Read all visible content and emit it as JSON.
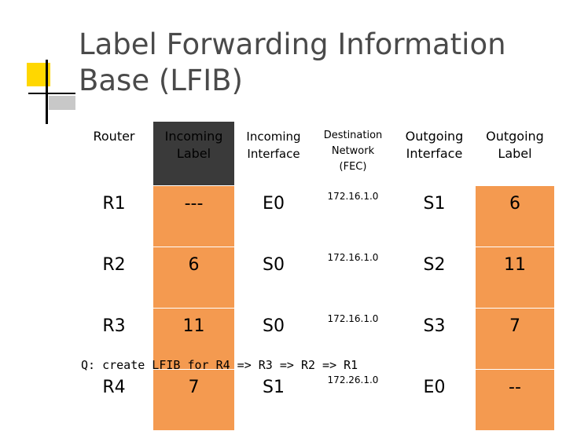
{
  "slide": {
    "title_line1": "Label Forwarding Information",
    "title_line2": "Base (LFIB)"
  },
  "table": {
    "headers": {
      "router": "Router",
      "incoming_label_line1": "Incoming",
      "incoming_label_line2": "Label",
      "incoming_interface_line1": "Incoming",
      "incoming_interface_line2": "Interface",
      "destination_line1": "Destination",
      "destination_line2": "Network",
      "destination_line3": "(FEC)",
      "outgoing_interface_line1": "Outgoing",
      "outgoing_interface_line2": "Interface",
      "outgoing_label_line1": "Outgoing",
      "outgoing_label_line2": "Label"
    },
    "rows": [
      {
        "router": "R1",
        "incoming_label": "---",
        "incoming_interface": "E0",
        "destination": "172.16.1.0",
        "outgoing_interface": "S1",
        "outgoing_label": "6"
      },
      {
        "router": "R2",
        "incoming_label": "6",
        "incoming_interface": "S0",
        "destination": "172.16.1.0",
        "outgoing_interface": "S2",
        "outgoing_label": "11"
      },
      {
        "router": "R3",
        "incoming_label": "11",
        "incoming_interface": "S0",
        "destination": "172.16.1.0",
        "outgoing_interface": "S3",
        "outgoing_label": "7"
      },
      {
        "router": "R4",
        "incoming_label": "7",
        "incoming_interface": "S1",
        "destination": "172.26.1.0",
        "outgoing_interface": "E0",
        "outgoing_label": "--"
      }
    ]
  },
  "note": "Q: create LFIB for R4 => R3 => R2 => R1",
  "colors": {
    "accent_orange": "#f49a50",
    "header_dark": "#3a3a3a",
    "deco_yellow": "#ffd700",
    "title_gray": "#4a4a4a"
  }
}
